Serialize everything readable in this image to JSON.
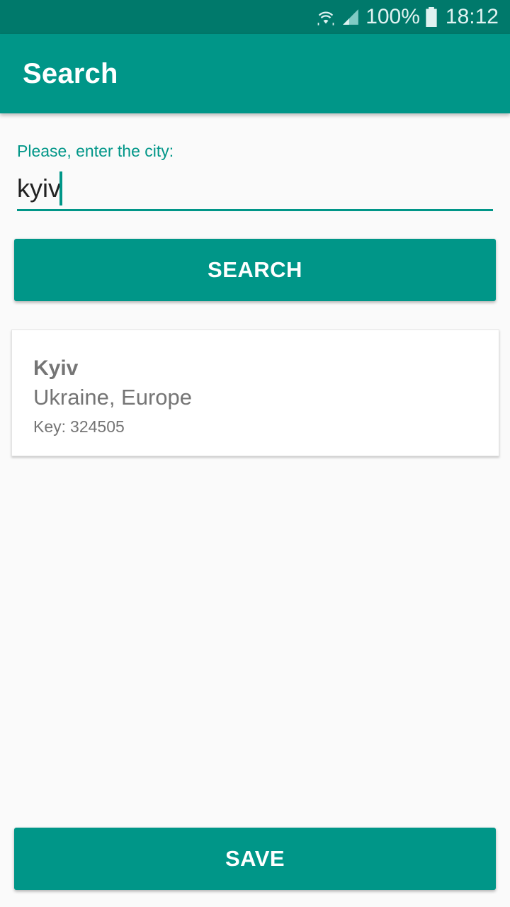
{
  "status_bar": {
    "battery": "100%",
    "time": "18:12",
    "icons": [
      "wifi-icon",
      "signal-icon",
      "battery-icon"
    ]
  },
  "app_bar": {
    "title": "Search"
  },
  "search_form": {
    "label": "Please, enter the city:",
    "value": "kyiv",
    "button_label": "SEARCH"
  },
  "result": {
    "city": "Kyiv",
    "region": "Ukraine, Europe",
    "key_label": "Key:",
    "key_value": "324505"
  },
  "footer": {
    "save_label": "SAVE"
  },
  "colors": {
    "primary": "#009688",
    "primary_dark": "#00796b",
    "background": "#fafafa",
    "secondary_text": "#757575"
  }
}
